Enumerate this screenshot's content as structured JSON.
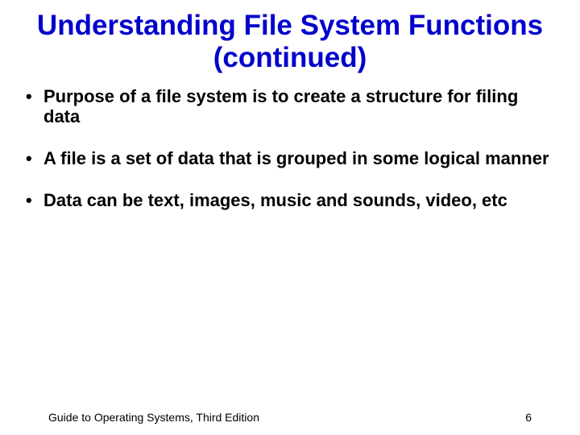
{
  "title": "Understanding File System Functions (continued)",
  "bullets": [
    "Purpose of a file system is to create a structure for filing data",
    "A file is a set of data that is grouped in some logical manner",
    "Data can be text, images, music and sounds, video, etc"
  ],
  "footer": {
    "text": "Guide to Operating Systems, Third Edition",
    "page": "6"
  }
}
